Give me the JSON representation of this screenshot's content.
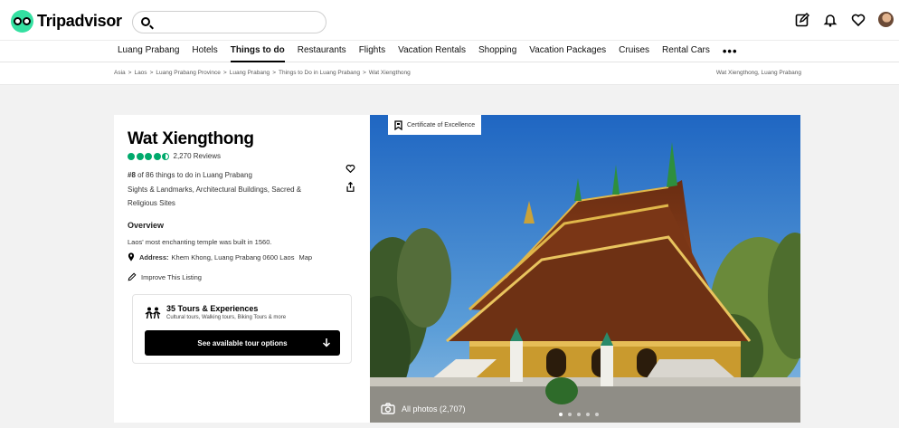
{
  "header": {
    "logo_text": "Tripadvisor",
    "search_placeholder": "",
    "icons": [
      "edit-icon",
      "bell-icon",
      "heart-icon"
    ]
  },
  "nav": {
    "items": [
      "Luang Prabang",
      "Hotels",
      "Things to do",
      "Restaurants",
      "Flights",
      "Vacation Rentals",
      "Shopping",
      "Vacation Packages",
      "Cruises",
      "Rental Cars"
    ],
    "active": "Things to do",
    "more": "•••"
  },
  "breadcrumb": {
    "items": [
      "Asia",
      "Laos",
      "Luang Prabang Province",
      "Luang Prabang",
      "Things to Do in Luang Prabang",
      "Wat Xiengthong"
    ],
    "separator": ">",
    "right": "Wat Xiengthong, Luang Prabang"
  },
  "attraction": {
    "title": "Wat Xiengthong",
    "rating": 4.5,
    "reviews": "2,270 Reviews",
    "rank_prefix": "#8",
    "rank_rest": " of 86 things to do in Luang Prabang",
    "categories": "Sights & Landmarks, Architectural Buildings, Sacred & Religious Sites",
    "overview_heading": "Overview",
    "overview_text": "Laos' most enchanting temple was built in 1560.",
    "address_label": "Address:",
    "address_value": "Khem Khong, Luang Prabang 0600 Laos",
    "map_label": "Map",
    "improve_label": "Improve This Listing"
  },
  "tours": {
    "title": "35 Tours & Experiences",
    "subtitle": "Cultural tours, Walking tours, Biking Tours & more",
    "button": "See available tour options"
  },
  "photo": {
    "badge": "Certificate of Excellence",
    "all_photos": "All photos (2,707)",
    "dot_count": 5,
    "active_dot": 0
  },
  "colors": {
    "brand_green": "#34e0a1",
    "rating_green": "#00aa6c",
    "button_black": "#000000"
  }
}
